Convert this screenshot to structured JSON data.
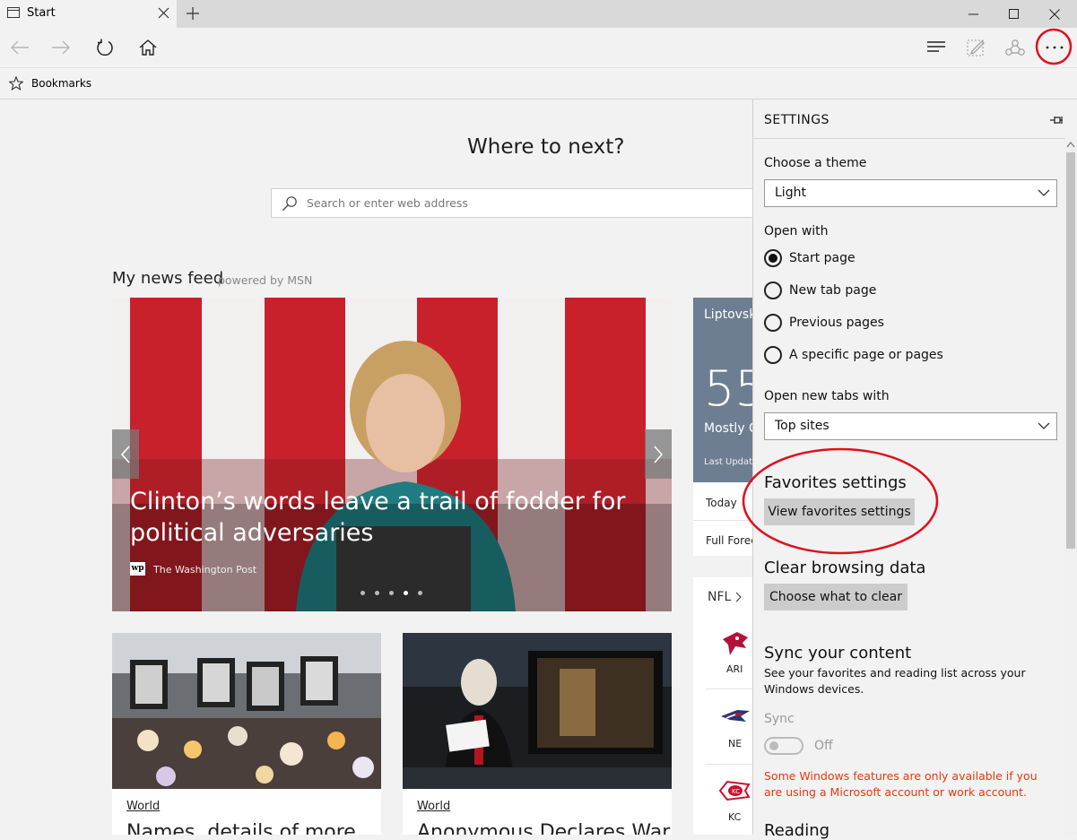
{
  "tab": {
    "title": "Start"
  },
  "favorites_bar": {
    "label": "Bookmarks"
  },
  "start": {
    "heading": "Where to next?",
    "search_placeholder": "Search or enter web address",
    "feed_title": "My news feed",
    "feed_powered": "powered by MSN"
  },
  "hero": {
    "headline": "Clinton’s words leave a trail of fodder for political adversaries",
    "source": "The Washington Post",
    "source_logo": "wp",
    "active_slide": 4,
    "slide_count": 5
  },
  "cards": [
    {
      "category": "World",
      "title": "Names, details of more"
    },
    {
      "category": "World",
      "title": "Anonymous Declares War"
    }
  ],
  "weather": {
    "location": "Liptovsk",
    "temp": "55",
    "condition": "Mostly C",
    "updated": "Last Updat",
    "today": "Today",
    "full_forecast": "Full Forec"
  },
  "nfl": {
    "label": "NFL",
    "teams": [
      "ARI",
      "NE",
      "KC"
    ]
  },
  "settings": {
    "title": "SETTINGS",
    "theme_label": "Choose a theme",
    "theme_value": "Light",
    "open_with_label": "Open with",
    "open_with_options": [
      "Start page",
      "New tab page",
      "Previous pages",
      "A specific page or pages"
    ],
    "open_with_selected": 0,
    "new_tabs_label": "Open new tabs with",
    "new_tabs_value": "Top sites",
    "favorites_heading": "Favorites settings",
    "favorites_button": "View favorites settings",
    "clear_heading": "Clear browsing data",
    "clear_button": "Choose what to clear",
    "sync_heading": "Sync your content",
    "sync_desc": "See your favorites and reading list across your Windows devices.",
    "sync_label": "Sync",
    "sync_state": "Off",
    "sync_warning": "Some Windows features are only available if you are using a Microsoft account or work account.",
    "reading_heading": "Reading"
  },
  "colors": {
    "highlight_circle": "#e0101e",
    "warning_text": "#e8380d",
    "hero_bg": "#b71c25",
    "weather_bg": "#6d7e92"
  }
}
